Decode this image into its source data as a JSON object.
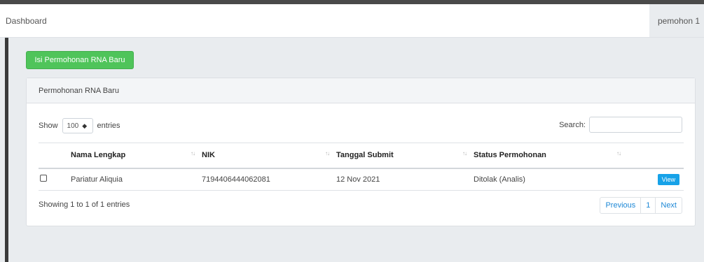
{
  "navbar": {
    "brand": "Dashboard",
    "user": "pemohon 1"
  },
  "actions": {
    "new_button": "Isi Permohonan RNA Baru"
  },
  "card": {
    "title": "Permohonan RNA Baru"
  },
  "length": {
    "show": "Show",
    "value": "100",
    "entries": "entries"
  },
  "search": {
    "label": "Search:",
    "value": ""
  },
  "table": {
    "columns": [
      "Nama Lengkap",
      "NIK",
      "Tanggal Submit",
      "Status Permohonan"
    ],
    "rows": [
      {
        "nama": "Pariatur Aliquia",
        "nik": "7194406444062081",
        "tanggal": "12 Nov 2021",
        "status": "Ditolak (Analis)",
        "action": "View"
      }
    ]
  },
  "footer": {
    "info": "Showing 1 to 1 of 1 entries",
    "previous": "Previous",
    "page": "1",
    "next": "Next"
  }
}
